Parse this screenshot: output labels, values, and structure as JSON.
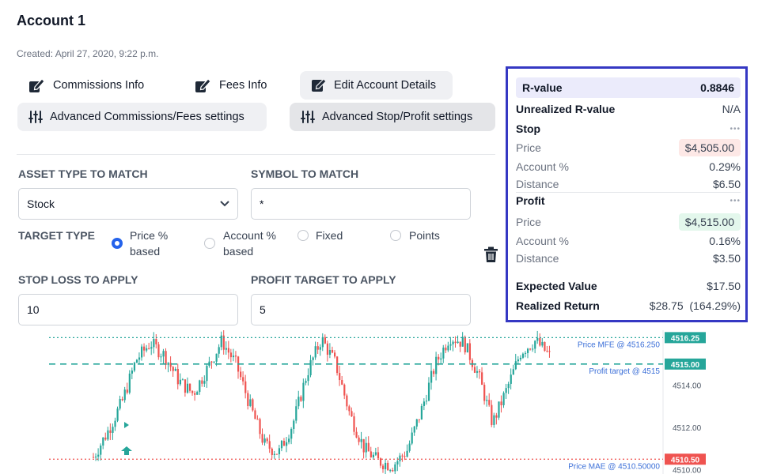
{
  "header": {
    "title": "Account 1",
    "created": "Created: April 27, 2020, 9:22 p.m."
  },
  "buttons": {
    "commissions": "Commissions Info",
    "fees": "Fees Info",
    "edit": "Edit Account Details",
    "adv_comm": "Advanced Commissions/Fees settings",
    "adv_stop": "Advanced Stop/Profit settings"
  },
  "form": {
    "asset_type_label": "ASSET TYPE TO MATCH",
    "asset_type_value": "Stock",
    "symbol_label": "SYMBOL TO MATCH",
    "symbol_value": "*",
    "target_type_label": "TARGET TYPE",
    "target_options": [
      {
        "line1": "Price %",
        "line2": "based",
        "selected": true
      },
      {
        "line1": "Account %",
        "line2": "based",
        "selected": false
      },
      {
        "line1": "Fixed",
        "line2": "",
        "selected": false
      },
      {
        "line1": "Points",
        "line2": "",
        "selected": false
      }
    ],
    "stop_loss_label": "STOP LOSS TO APPLY",
    "stop_loss_value": "10",
    "profit_target_label": "PROFIT TARGET TO APPLY",
    "profit_target_value": "5"
  },
  "panel": {
    "r_value_label": "R-value",
    "r_value": "0.8846",
    "unrealized_label": "Unrealized R-value",
    "unrealized_value": "N/A",
    "stop_label": "Stop",
    "stop_price_label": "Price",
    "stop_price": "$4,505.00",
    "stop_account_label": "Account %",
    "stop_account": "0.29%",
    "stop_distance_label": "Distance",
    "stop_distance": "$6.50",
    "profit_label": "Profit",
    "profit_price_label": "Price",
    "profit_price": "$4,515.00",
    "profit_account_label": "Account %",
    "profit_account": "0.16%",
    "profit_distance_label": "Distance",
    "profit_distance": "$3.50",
    "expected_label": "Expected Value",
    "expected_value": "$17.50",
    "realized_label": "Realized Return",
    "realized_value": "$28.75  (164.29%)",
    "more_glyph": "•••"
  },
  "chart_data": {
    "type": "candlestick",
    "ylim": [
      4509.8,
      4516.6
    ],
    "y_ticks": [
      "4514.00",
      "4512.00",
      "4510.00"
    ],
    "markers": [
      {
        "label": "Price MFE @ 4516.250",
        "price": 4516.25,
        "badge": "4516.25",
        "color": "#26a69a",
        "style": "dotted"
      },
      {
        "label": "Profit target @ 4515",
        "price": 4515.0,
        "badge": "4515.00",
        "color": "#26a69a",
        "style": "dashed"
      },
      {
        "label": "Price MAE @ 4510.50000",
        "price": 4510.5,
        "badge": "4510.50",
        "color": "#ef5350",
        "style": "dotted"
      }
    ],
    "up_color": "#26a69a",
    "down_color": "#ef5350"
  }
}
